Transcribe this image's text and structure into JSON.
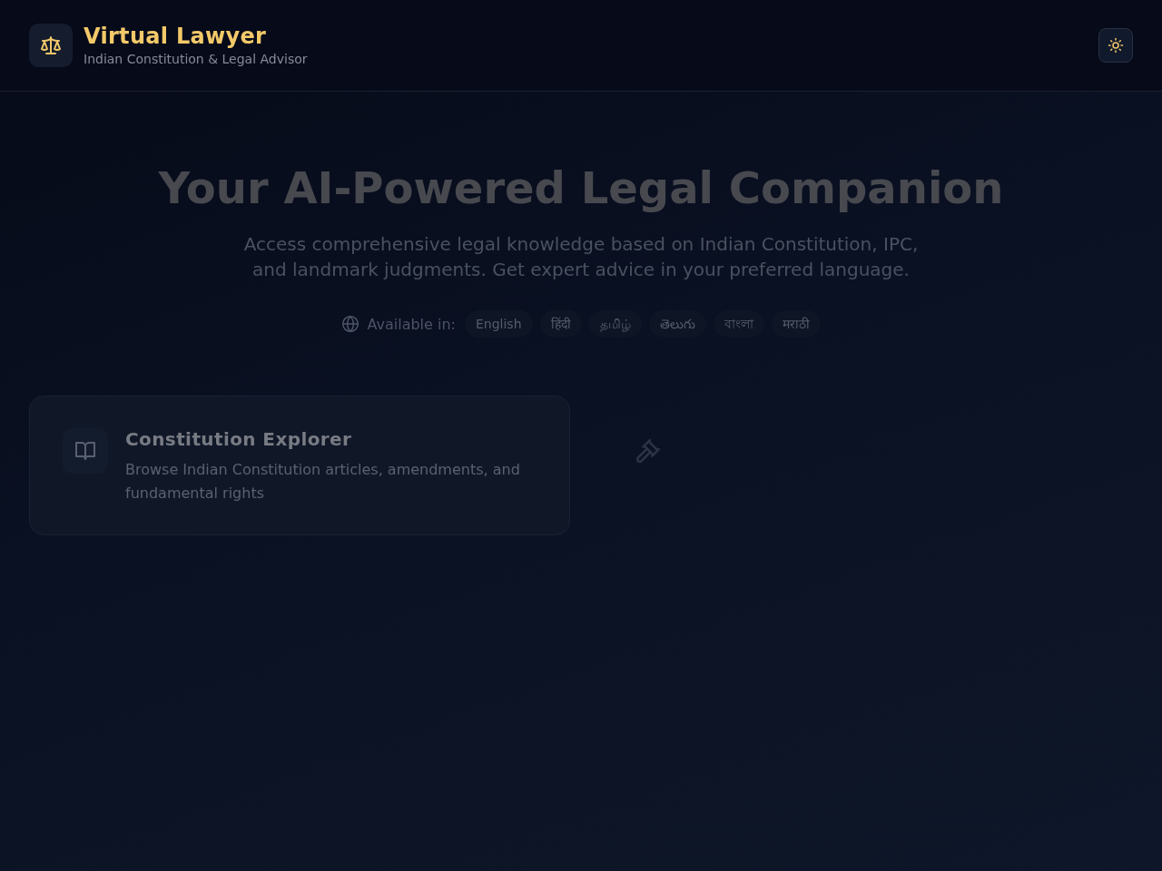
{
  "header": {
    "title": "Virtual Lawyer",
    "subtitle": "Indian Constitution & Legal Advisor"
  },
  "hero": {
    "title": "Your AI-Powered Legal Companion",
    "subtitle": "Access comprehensive legal knowledge based on Indian Constitution, IPC, and landmark judgments. Get expert advice in your preferred language."
  },
  "languages": {
    "label": "Available in:",
    "options": [
      "English",
      "हिंदी",
      "தமிழ்",
      "తెలుగు",
      "বাংলা",
      "मराठी"
    ]
  },
  "features": [
    {
      "kind": "book",
      "title": "Constitution Explorer",
      "description": "Browse Indian Constitution articles, amendments, and fundamental rights",
      "faded": false
    },
    {
      "kind": "gavel",
      "faded": true
    }
  ]
}
